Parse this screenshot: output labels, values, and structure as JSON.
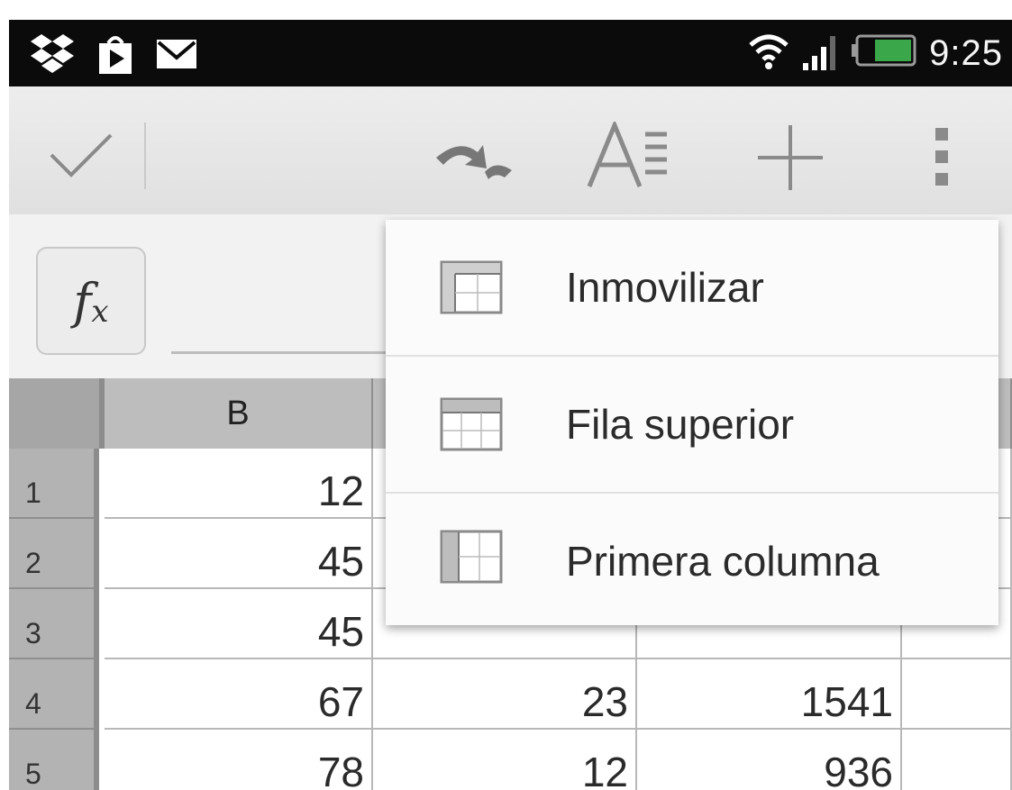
{
  "status_bar": {
    "time": "9:25",
    "icons": [
      "dropbox-icon",
      "play-store-icon",
      "mail-icon",
      "wifi-icon",
      "signal-icon",
      "battery-icon"
    ]
  },
  "toolbar": {
    "icons": [
      "checkmark-icon",
      "undo-icon",
      "text-format-icon",
      "add-icon",
      "overflow-menu-icon"
    ]
  },
  "formula_bar": {
    "fx_label": "fx",
    "value": ""
  },
  "grid": {
    "column_headers": [
      "B"
    ],
    "row_headers": [
      "1",
      "2",
      "3",
      "4",
      "5"
    ],
    "column_b": [
      "12",
      "45",
      "45",
      "67",
      "78"
    ],
    "row4": {
      "col_c": "23",
      "col_d": "1541"
    },
    "row5": {
      "col_c": "12",
      "col_d": "936"
    }
  },
  "menu": {
    "items": [
      {
        "label": "Inmovilizar",
        "icon": "freeze-panes-icon"
      },
      {
        "label": "Fila superior",
        "icon": "freeze-top-row-icon"
      },
      {
        "label": "Primera columna",
        "icon": "freeze-first-column-icon"
      }
    ]
  },
  "colors": {
    "status_bar": "#0b0b0b",
    "toolbar": "#e6e6e6",
    "header_gray": "#bdbdbd",
    "battery_green": "#3aa84a"
  }
}
